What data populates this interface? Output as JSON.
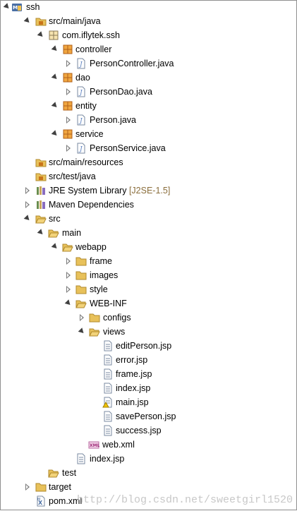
{
  "tree": {
    "project": "ssh",
    "src_main_java": "src/main/java",
    "package": "com.iflytek.ssh",
    "controller": "controller",
    "person_controller": "PersonController.java",
    "dao": "dao",
    "person_dao": "PersonDao.java",
    "entity": "entity",
    "person": "Person.java",
    "service": "service",
    "person_service": "PersonService.java",
    "src_main_resources": "src/main/resources",
    "src_test_java": "src/test/java",
    "jre": "JRE System Library",
    "jre_version": "[J2SE-1.5]",
    "maven": "Maven Dependencies",
    "src": "src",
    "main": "main",
    "webapp": "webapp",
    "frame": "frame",
    "images": "images",
    "style": "style",
    "web_inf": "WEB-INF",
    "configs": "configs",
    "views": "views",
    "edit_person": "editPerson.jsp",
    "error": "error.jsp",
    "frame_jsp": "frame.jsp",
    "index_jsp_views": "index.jsp",
    "main_jsp": "main.jsp",
    "save_person": "savePerson.jsp",
    "success": "success.jsp",
    "web_xml": "web.xml",
    "index_jsp": "index.jsp",
    "test": "test",
    "target": "target",
    "pom": "pom.xml"
  },
  "watermark": "http://blog.csdn.net/sweetgirl1520",
  "colors": {
    "folder": "#e8c15a",
    "package": "#c8741a",
    "java_file": "#5a7fbf",
    "decoration": "#8a6d3b"
  }
}
